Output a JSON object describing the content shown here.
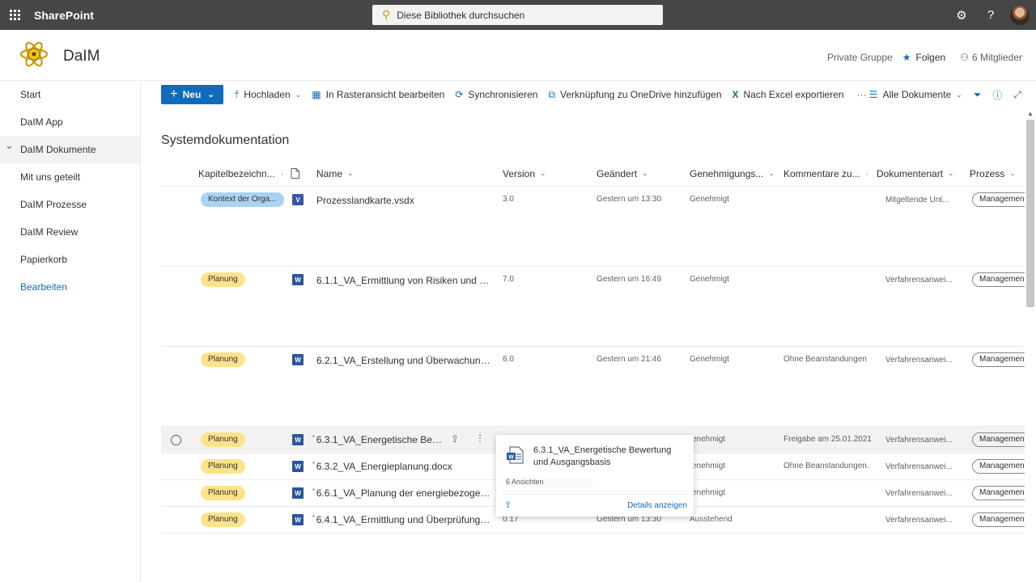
{
  "suite": {
    "brand": "SharePoint",
    "search_placeholder": "Diese Bibliothek durchsuchen"
  },
  "site": {
    "title": "DaIM",
    "group_type": "Private Gruppe",
    "follow_label": "Folgen",
    "members_label": "6 Mitglieder"
  },
  "nav": {
    "items": [
      {
        "label": "Start"
      },
      {
        "label": "DaIM App"
      },
      {
        "label": "DaIM Dokumente"
      },
      {
        "label": "Mit uns geteilt"
      },
      {
        "label": "DaIM Prozesse"
      },
      {
        "label": "DaIM Review"
      },
      {
        "label": "Papierkorb"
      },
      {
        "label": "Bearbeiten"
      }
    ]
  },
  "commands": {
    "new": "Neu",
    "upload": "Hochladen",
    "grid_edit": "In Rasteransicht bearbeiten",
    "sync": "Synchronisieren",
    "onedrive": "Verknüpfung zu OneDrive hinzufügen",
    "excel": "Nach Excel exportieren",
    "more": "···",
    "view": "Alle Dokumente"
  },
  "library": {
    "title": "Systemdokumentation",
    "columns": {
      "chapter": "Kapitelbezeichn...",
      "name": "Name",
      "version": "Version",
      "modified": "Geändert",
      "approval": "Genehmigungs...",
      "comments": "Kommentare zu...",
      "doctype": "Dokumentenart",
      "process": "Prozess"
    },
    "rows": [
      {
        "chapter": "Kontext der Orga...",
        "name": "Prozesslandkarte.vsdx",
        "version": "3.0",
        "modified": "Gestern um 13:30",
        "approval": "Genehmigt",
        "comments": "",
        "doctype": "Mitgeltende Unt...",
        "process": "Management"
      },
      {
        "chapter": "Planung",
        "name": "6.1.1_VA_Ermittlung von Risiken und Chanc...",
        "version": "7.0",
        "modified": "Gestern um 16:49",
        "approval": "Genehmigt",
        "comments": "",
        "doctype": "Verfahrensanwei...",
        "process": "Management"
      },
      {
        "chapter": "Planung",
        "name": "6.2.1_VA_Erstellung und Überwachung der ...",
        "version": "6.0",
        "modified": "Gestern um 21:46",
        "approval": "Genehmigt",
        "comments": "Ohne Beanstandungen",
        "doctype": "Verfahrensanwei...",
        "process": "Management"
      },
      {
        "chapter": "Planung",
        "name": "6.3.1_VA_Energetische Bewertu...",
        "version": "",
        "modified": "",
        "approval": "enehmigt",
        "comments": "Freigabe am 25.01.2021",
        "doctype": "Verfahrensanwei...",
        "process": "Management"
      },
      {
        "chapter": "Planung",
        "name": "6.3.2_VA_Energieplanung.docx",
        "version": "",
        "modified": "",
        "approval": "enehmigt",
        "comments": "Ohne Beanstandungen.",
        "doctype": "Verfahrensanwei...",
        "process": "Management"
      },
      {
        "chapter": "Planung",
        "name": "6.6.1_VA_Planung der energiebezogenen D...",
        "version": "",
        "modified": "",
        "approval": "enehmigt",
        "comments": "",
        "doctype": "Verfahrensanwei...",
        "process": "Management"
      },
      {
        "chapter": "Planung",
        "name": "6.4.1_VA_Ermittlung und Überprüfung von ...",
        "version": "0.17",
        "modified": "Gestern um 13:30",
        "approval": "Ausstehend",
        "comments": "",
        "doctype": "Verfahrensanwei...",
        "process": "Management"
      }
    ]
  },
  "hovercard": {
    "title": "6.3.1_VA_Energetische Bewertung und Ausgangsbasis",
    "views": "6 Ansichten",
    "details": "Details anzeigen"
  },
  "colors": {
    "accent": "#0f6cbd",
    "suitebar": "#464646",
    "pill_yellow": "#fce38a",
    "pill_blue": "#a9d3f2"
  }
}
